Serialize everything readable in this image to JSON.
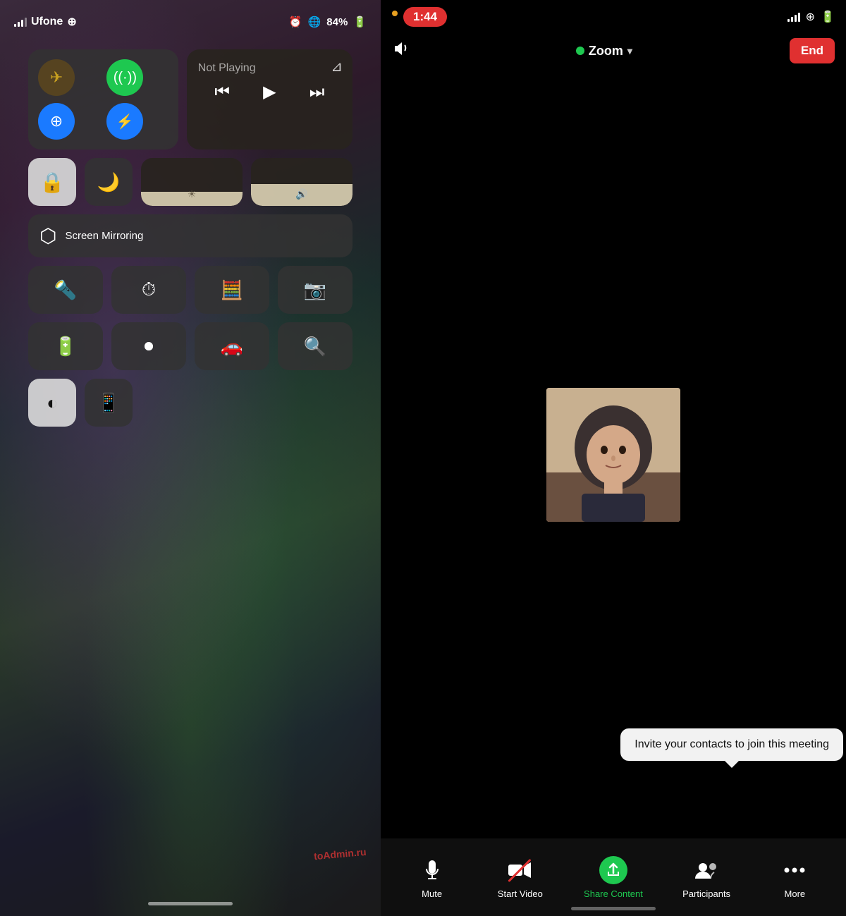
{
  "left": {
    "status": {
      "carrier": "Ufone",
      "battery": "84%",
      "wifi": true
    },
    "connectivity": {
      "airplane_label": "✈",
      "cellular_label": "📶",
      "wifi_label": "WiFi",
      "bluetooth_label": "Bluetooth"
    },
    "media": {
      "not_playing": "Not Playing",
      "airplay_icon": "airplay",
      "rewind_icon": "⏮",
      "play_icon": "▶",
      "forward_icon": "⏭"
    },
    "controls": {
      "lock_label": "Screen Lock",
      "moon_label": "Do Not Disturb",
      "screen_mirror": "Screen Mirroring",
      "brightness": "Brightness",
      "volume": "Volume"
    },
    "grid": [
      {
        "icon": "🔦",
        "label": "Torch"
      },
      {
        "icon": "⏱",
        "label": "Timer"
      },
      {
        "icon": "🧮",
        "label": "Calculator"
      },
      {
        "icon": "📷",
        "label": "Camera"
      },
      {
        "icon": "🔋",
        "label": "Low Power"
      },
      {
        "icon": "⏺",
        "label": "Screen Record"
      },
      {
        "icon": "🚗",
        "label": "CarPlay"
      },
      {
        "icon": "🔍",
        "label": "Magnifier"
      }
    ],
    "last_row": [
      {
        "icon": "contrast",
        "label": "Dark Mode"
      },
      {
        "icon": "remote",
        "label": "Remote"
      }
    ],
    "watermark": "toAdmin.ru"
  },
  "right": {
    "status": {
      "time": "1:44",
      "time_bg": "#e03030"
    },
    "toolbar": {
      "app_name": "Zoom",
      "end_label": "End",
      "audio_icon": "speaker"
    },
    "invite_tooltip": "Invite your contacts to join this meeting",
    "bottom": {
      "mute_label": "Mute",
      "start_video_label": "Start Video",
      "share_content_label": "Share Content",
      "participants_label": "Participants",
      "more_label": "More"
    }
  }
}
